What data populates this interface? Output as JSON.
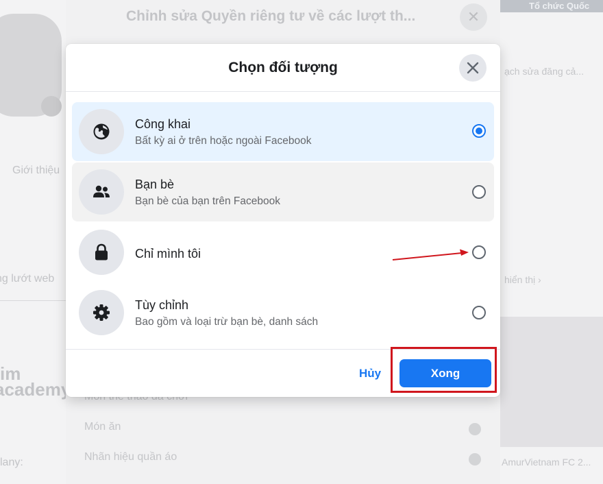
{
  "background": {
    "dialog_title": "Chỉnh sửa Quyền riêng tư về các lượt th...",
    "list_items": [
      "Môn thể thao đã chơi",
      "Món ăn",
      "Nhãn hiệu quần áo"
    ],
    "left_fragments": [
      "Giới thiệu",
      "ng lướt web",
      "im",
      "academy",
      "lany:"
    ],
    "right_fragments": [
      "Tổ chức Quốc",
      "ạch sửa đăng cả...",
      "hiển thị ›",
      "AmurVietnam FC 2..."
    ]
  },
  "modal": {
    "title": "Chọn đối tượng",
    "options": [
      {
        "title": "Công khai",
        "subtitle": "Bất kỳ ai ở trên hoặc ngoài Facebook",
        "icon": "globe-icon",
        "checked": true
      },
      {
        "title": "Bạn bè",
        "subtitle": "Bạn bè của bạn trên Facebook",
        "icon": "friends-icon",
        "checked": false
      },
      {
        "title": "Chỉ mình tôi",
        "subtitle": "",
        "icon": "lock-icon",
        "checked": false
      },
      {
        "title": "Tùy chỉnh",
        "subtitle": "Bao gồm và loại trừ bạn bè, danh sách",
        "icon": "gear-icon",
        "checked": false
      }
    ],
    "cancel_label": "Hủy",
    "done_label": "Xong"
  },
  "colors": {
    "accent": "#1877f2",
    "selected_bg": "#e7f3ff",
    "annotation": "#d0161d"
  }
}
